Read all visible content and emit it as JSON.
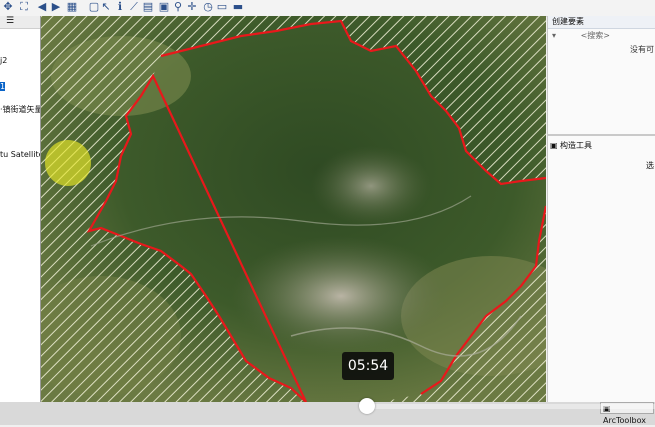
{
  "toolbar": {
    "icons": [
      "pan-icon",
      "full-extent-icon",
      "zoom-in-fixed-icon",
      "zoom-out-fixed-icon",
      "back-icon",
      "forward-icon",
      "select-features-icon",
      "clear-selection-icon",
      "select-elements-icon",
      "identify-icon",
      "measure-icon",
      "html-popup-icon",
      "create-viewer-icon",
      "find-icon",
      "go-to-xy-icon",
      "time-slider-icon",
      "layout-view-icon",
      "data-view-icon"
    ]
  },
  "toc": {
    "items": [
      "j2",
      "1",
      "·镇街道矢量",
      "tu Satellite"
    ]
  },
  "create_features": {
    "title": "创建要素",
    "search_placeholder": "<搜索>",
    "empty_text": "没有可"
  },
  "construct_tools": {
    "title": "构造工具",
    "partial_text": "选"
  },
  "status": {
    "arctoolbox_label": "ArcToolbox"
  },
  "video": {
    "time": "05:54",
    "progress": 0.56
  },
  "colors": {
    "boundary": "#e8181b",
    "hatch": "#f2f2d8"
  }
}
